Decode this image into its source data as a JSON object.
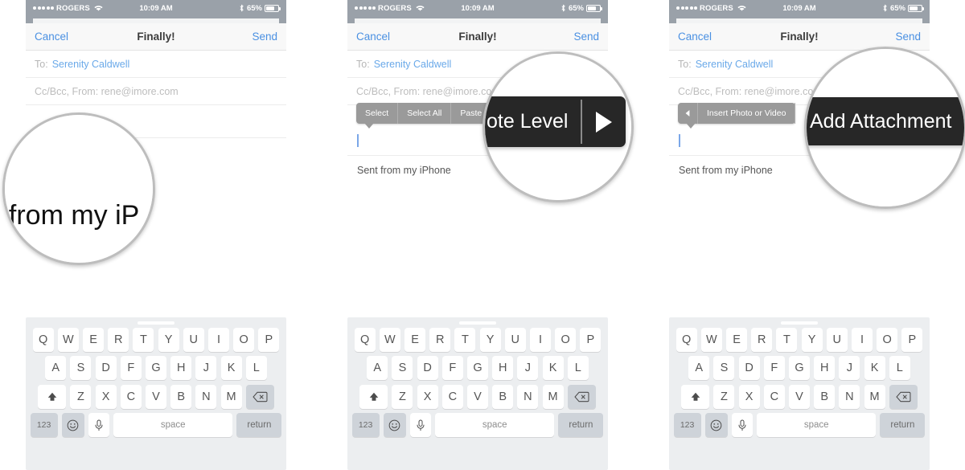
{
  "status_bar": {
    "signal_dots": 5,
    "carrier": "ROGERS",
    "wifi_icon": "wifi-icon",
    "time": "10:09 AM",
    "bluetooth_icon": "bluetooth-icon",
    "battery_percent": "65%",
    "battery_icon": "battery-icon"
  },
  "nav": {
    "cancel": "Cancel",
    "title": "Finally!",
    "send": "Send"
  },
  "compose": {
    "to_label": "To:",
    "to_value": "Serenity Caldwell",
    "cc_label": "Cc/Bcc, From:",
    "cc_value": "rene@imore.com",
    "cc_full_line": "Cc/Bcc, From:  rene@imore.com",
    "signature": "Sent from my iPhone"
  },
  "panels": [
    {
      "id": "panel-1",
      "magnifier": {
        "type": "text",
        "content": "t from my iP"
      },
      "edit_menu": null
    },
    {
      "id": "panel-2",
      "magnifier": {
        "type": "dark-popup",
        "label": "Quote Level",
        "visible_label": "ote Level",
        "arrow_icon": "play-triangle-icon"
      },
      "edit_menu": {
        "items": [
          "Select",
          "Select All",
          "Paste"
        ],
        "visible_last": "Pa"
      }
    },
    {
      "id": "panel-3",
      "magnifier": {
        "type": "dark-popup",
        "label": "Add Attachment",
        "visible_label": "Add Attachment",
        "arrow_icon": null
      },
      "edit_menu": {
        "back_arrow_icon": "triangle-left-icon",
        "items": [
          "Insert Photo or Video"
        ]
      }
    }
  ],
  "keyboard": {
    "grabber": "keyboard-grabber",
    "row1": [
      "Q",
      "W",
      "E",
      "R",
      "T",
      "Y",
      "U",
      "I",
      "O",
      "P"
    ],
    "row2": [
      "A",
      "S",
      "D",
      "F",
      "G",
      "H",
      "J",
      "K",
      "L"
    ],
    "row3": [
      "Z",
      "X",
      "C",
      "V",
      "B",
      "N",
      "M"
    ],
    "shift_icon": "shift-arrow-icon",
    "backspace_icon": "backspace-icon",
    "numbers_key": "123",
    "emoji_icon": "smiley-face-icon",
    "mic_icon": "microphone-icon",
    "space_key": "space",
    "return_key": "return"
  },
  "colors": {
    "status_bar_bg": "#9aa1a9",
    "accent_blue": "#4a90e2",
    "nav_bg": "#f8f8f8",
    "menu_gray": "#9a9a9a",
    "popup_dark": "#272727",
    "keyboard_bg": "#eceef0",
    "key_gray": "#ced3d9"
  }
}
